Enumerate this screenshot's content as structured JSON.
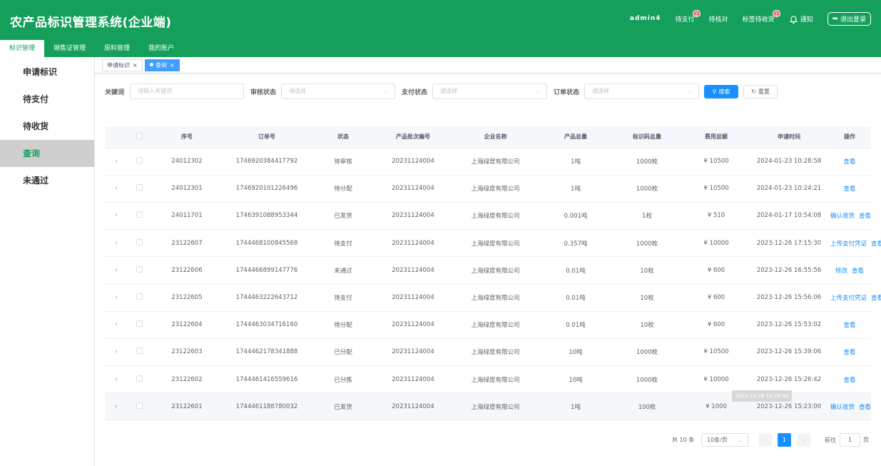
{
  "app": {
    "title": "农产品标识管理系统(企业端)"
  },
  "topbar": {
    "user": "admin4",
    "pending_payment": {
      "label": "待支付",
      "badge": "2"
    },
    "pending_review": {
      "label": "待核对"
    },
    "label_receipt": {
      "label": "标签待收货",
      "badge": "2"
    },
    "notify": {
      "label": "通知"
    },
    "logout": {
      "label": "退出登录"
    }
  },
  "menu": [
    {
      "label": "标识管理",
      "active": true
    },
    {
      "label": "销售证管理"
    },
    {
      "label": "原料管理"
    },
    {
      "label": "我的账户"
    }
  ],
  "sidebar": [
    {
      "label": "申请标识"
    },
    {
      "label": "待支付"
    },
    {
      "label": "待收货"
    },
    {
      "label": "查询",
      "active": true
    },
    {
      "label": "未通过"
    }
  ],
  "tags": [
    {
      "label": "申请标识",
      "close": "×"
    },
    {
      "label": "查询",
      "close": "×",
      "active": true
    }
  ],
  "filters": {
    "keyword_label": "关键词",
    "keyword_placeholder": "请输入关键词",
    "review_label": "审核状态",
    "review_placeholder": "请选择",
    "pay_label": "支付状态",
    "pay_placeholder": "请选择",
    "order_label": "订单状态",
    "order_placeholder": "请选择",
    "search_btn": "搜索",
    "reset_btn": "重置"
  },
  "table": {
    "headers": [
      "序号",
      "订单号",
      "状态",
      "产品批次编号",
      "企业名称",
      "产品总量",
      "标识码总量",
      "费用总额",
      "申请时间",
      "操作"
    ],
    "rows": [
      {
        "no": "24012302",
        "order": "1746920384417792",
        "status": "待审核",
        "batch": "20231124004",
        "company": "上海绿度有限公司",
        "qty": "1吨",
        "codes": "1000枚",
        "fee": "¥ 10500",
        "time": "2024-01-23 10:28:58",
        "ops": [
          "查看"
        ]
      },
      {
        "no": "24012301",
        "order": "1746920101226496",
        "status": "待分配",
        "batch": "20231124004",
        "company": "上海绿度有限公司",
        "qty": "1吨",
        "codes": "1000枚",
        "fee": "¥ 10500",
        "time": "2024-01-23 10:24:21",
        "ops": [
          "查看"
        ]
      },
      {
        "no": "24011701",
        "order": "1746391088953344",
        "status": "已发货",
        "batch": "20231124004",
        "company": "上海绿度有限公司",
        "qty": "0.001吨",
        "codes": "1枚",
        "fee": "¥ 510",
        "time": "2024-01-17 10:54:08",
        "ops": [
          "确认收货",
          "查看"
        ]
      },
      {
        "no": "23122607",
        "order": "1744468100845568",
        "status": "待支付",
        "batch": "20231124004",
        "company": "上海绿度有限公司",
        "qty": "0.357吨",
        "codes": "1000枚",
        "fee": "¥ 10000",
        "time": "2023-12-26 17:15:30",
        "ops": [
          "上传支付凭证",
          "查看"
        ]
      },
      {
        "no": "23122606",
        "order": "1744466899147776",
        "status": "未通过",
        "batch": "20231124004",
        "company": "上海绿度有限公司",
        "qty": "0.01吨",
        "codes": "10枚",
        "fee": "¥ 600",
        "time": "2023-12-26 16:55:56",
        "ops": [
          "修改",
          "查看"
        ]
      },
      {
        "no": "23122605",
        "order": "1744463222643712",
        "status": "待支付",
        "batch": "20231124004",
        "company": "上海绿度有限公司",
        "qty": "0.01吨",
        "codes": "10枚",
        "fee": "¥ 600",
        "time": "2023-12-26 15:56:06",
        "ops": [
          "上传支付凭证",
          "查看"
        ]
      },
      {
        "no": "23122604",
        "order": "1744463034716160",
        "status": "待分配",
        "batch": "20231124004",
        "company": "上海绿度有限公司",
        "qty": "0.01吨",
        "codes": "10枚",
        "fee": "¥ 600",
        "time": "2023-12-26 15:53:02",
        "ops": [
          "查看"
        ]
      },
      {
        "no": "23122603",
        "order": "1744462178341888",
        "status": "已分配",
        "batch": "20231124004",
        "company": "上海绿度有限公司",
        "qty": "10吨",
        "codes": "1000枚",
        "fee": "¥ 10500",
        "time": "2023-12-26 15:39:06",
        "ops": [
          "查看"
        ]
      },
      {
        "no": "23122602",
        "order": "1744461416559616",
        "status": "已分拣",
        "batch": "20231124004",
        "company": "上海绿度有限公司",
        "qty": "10吨",
        "codes": "1000枚",
        "fee": "¥ 10000",
        "time": "2023-12-26 15:26:42",
        "ops": [
          "查看"
        ]
      },
      {
        "no": "23122601",
        "order": "1744461188780032",
        "status": "已发货",
        "batch": "20231124004",
        "company": "上海绿度有限公司",
        "qty": "1吨",
        "codes": "100枚",
        "fee": "¥ 1000",
        "time": "2023-12-26 15:23:00",
        "ops": [
          "确认收货",
          "查看"
        ]
      }
    ]
  },
  "tooltip": "2023-12-26 15:26:42",
  "pager": {
    "total": "共 10 条",
    "size": "10条/页",
    "current": "1",
    "goto_label": "前往",
    "goto_value": "1",
    "page_unit": "页"
  },
  "colors": {
    "primary_green": "#14a05a",
    "link_blue": "#1890ff"
  }
}
